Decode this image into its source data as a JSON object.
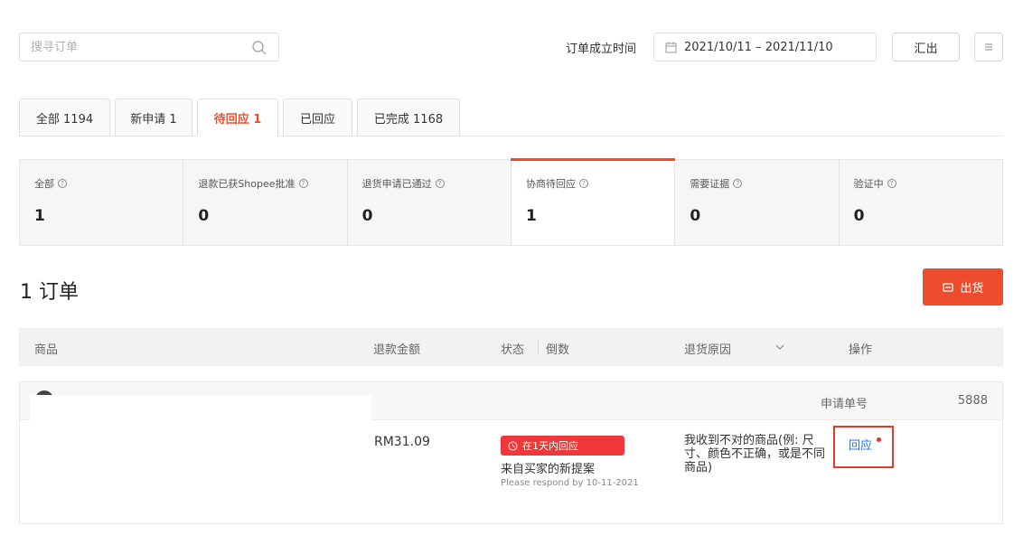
{
  "search": {
    "placeholder": "搜寻订单"
  },
  "date_filter": {
    "label": "订单成立时间",
    "range": "2021/10/11 – 2021/11/10"
  },
  "toolbar": {
    "export_label": "汇出"
  },
  "tabs": [
    {
      "label": "全部 1194"
    },
    {
      "label": "新申请 1"
    },
    {
      "label": "待回应 1"
    },
    {
      "label": "已回应"
    },
    {
      "label": "已完成 1168"
    }
  ],
  "sub_status": [
    {
      "label": "全部",
      "count": "1"
    },
    {
      "label": "退款已获Shopee批准",
      "count": "0"
    },
    {
      "label": "退货申请已通过",
      "count": "0"
    },
    {
      "label": "协商待回应",
      "count": "1"
    },
    {
      "label": "需要证据",
      "count": "0"
    },
    {
      "label": "验证中",
      "count": "0"
    }
  ],
  "orders_summary": "1 订单",
  "ship_button": "出货",
  "table": {
    "headers": {
      "product": "商品",
      "refund_amount": "退款金额",
      "status": "状态",
      "countdown": "倒数",
      "return_reason": "退货原因",
      "action": "操作"
    }
  },
  "order": {
    "apply_no_label": "申请单号",
    "apply_no": "5888",
    "amount": "RM31.09",
    "badge": "在1天内回应",
    "status_text": "来自买家的新提案",
    "deadline": "Please respond by 10-11-2021",
    "reason": "我收到不对的商品(例: 尺寸、颜色不正确，或是不同商品)",
    "action_label": "回应"
  },
  "colors": {
    "accent": "#ee4d2d",
    "link": "#2a6ee0",
    "badge": "#f0383a"
  },
  "icons": {
    "search": "search-icon",
    "calendar": "calendar-icon",
    "menu": "menu-icon",
    "ship": "printer-icon",
    "clock": "clock-icon",
    "chevron": "chevron-down-icon",
    "help": "help-icon"
  }
}
